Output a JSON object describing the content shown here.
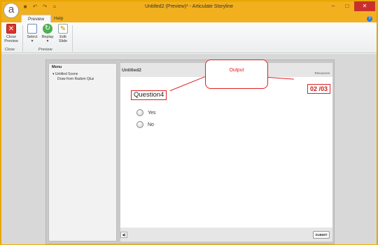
{
  "window": {
    "title": "Untitled2 (Preview)* - Articulate Storyline",
    "logo_letter": "a"
  },
  "tabs": [
    {
      "label": "Preview"
    },
    {
      "label": "Help"
    }
  ],
  "ribbon": {
    "buttons": [
      {
        "label_line1": "Close",
        "label_line2": "Preview"
      },
      {
        "label_line1": "Select",
        "label_line2": "▾"
      },
      {
        "label_line1": "Replay",
        "label_line2": "▾"
      },
      {
        "label_line1": "Edit",
        "label_line2": "Slide"
      }
    ],
    "groups": [
      {
        "label": "Close"
      },
      {
        "label": "Preview"
      }
    ]
  },
  "menu": {
    "title": "Menu",
    "scene": "▾ Untitled Scene",
    "slide": "Draw from Radom Qluz"
  },
  "slide": {
    "title": "Untitled2",
    "resources": "Resources",
    "question": "Question4",
    "counter": "02 /03",
    "options": [
      {
        "label": "Yes"
      },
      {
        "label": "No"
      }
    ],
    "submit": "SUBMIT"
  },
  "callout": {
    "text": "Output"
  },
  "colors": {
    "accent": "#f2b01e",
    "highlight": "#e02020"
  }
}
